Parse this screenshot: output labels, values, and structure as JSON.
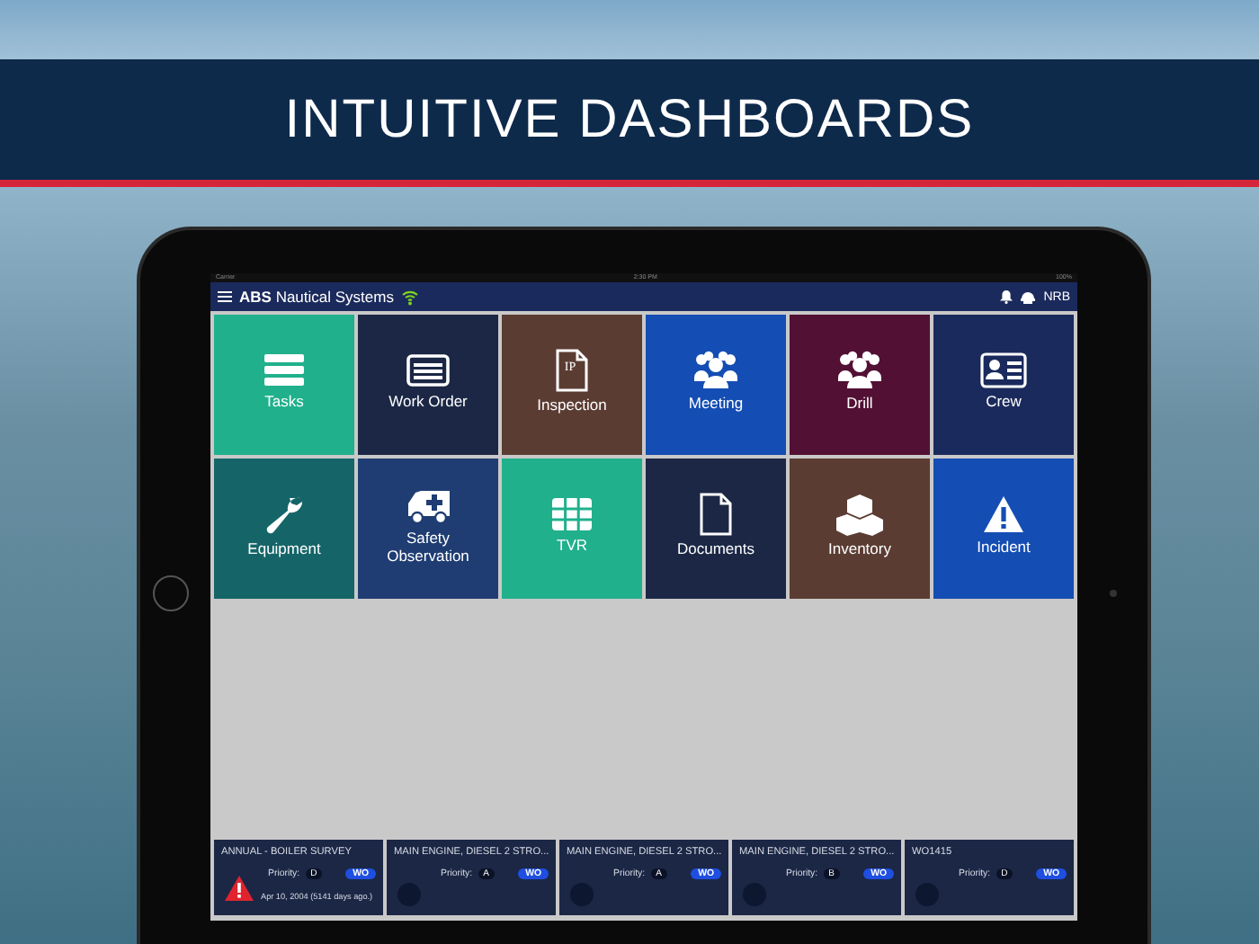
{
  "banner": {
    "title": "INTUITIVE DASHBOARDS"
  },
  "status_bar": {
    "carrier": "Carrier",
    "time": "2:30 PM",
    "battery": "100%"
  },
  "app_header": {
    "title": "**ABS** Nautical Systems",
    "user": "NRB"
  },
  "tiles": [
    {
      "label": "Tasks",
      "kind": "tasks",
      "color": "#20b08c"
    },
    {
      "label": "Work Order",
      "kind": "workorder",
      "color": "#1b2745"
    },
    {
      "label": "Inspection",
      "kind": "inspection",
      "color": "#5b3c33",
      "icon_text": "IP"
    },
    {
      "label": "Meeting",
      "kind": "meeting",
      "color": "#144db3"
    },
    {
      "label": "Drill",
      "kind": "drill",
      "color": "#521034"
    },
    {
      "label": "Crew",
      "kind": "crew",
      "color": "#1b2a5c"
    },
    {
      "label": "Equipment",
      "kind": "equipment",
      "color": "#156568"
    },
    {
      "label": "Safety Observation",
      "kind": "safety",
      "color": "#1f3d72"
    },
    {
      "label": "TVR",
      "kind": "tvr",
      "color": "#20b08c"
    },
    {
      "label": "Documents",
      "kind": "documents",
      "color": "#1b2745"
    },
    {
      "label": "Inventory",
      "kind": "inventory",
      "color": "#5b3c33"
    },
    {
      "label": "Incident",
      "kind": "incident",
      "color": "#144db3"
    }
  ],
  "work_orders": [
    {
      "title": "ANNUAL - BOILER SURVEY",
      "priority_label": "Priority:",
      "priority": "D",
      "badge": "WO",
      "kind": "alert",
      "date": "Apr 10, 2004 (5141 days ago.)"
    },
    {
      "title": "MAIN ENGINE, DIESEL 2 STRO...",
      "priority_label": "Priority:",
      "priority": "A",
      "badge": "WO",
      "kind": "plain"
    },
    {
      "title": "MAIN ENGINE, DIESEL 2 STRO...",
      "priority_label": "Priority:",
      "priority": "A",
      "badge": "WO",
      "kind": "plain"
    },
    {
      "title": "MAIN ENGINE, DIESEL 2 STRO...",
      "priority_label": "Priority:",
      "priority": "B",
      "badge": "WO",
      "kind": "plain"
    },
    {
      "title": "WO1415",
      "priority_label": "Priority:",
      "priority": "D",
      "badge": "WO",
      "kind": "plain"
    }
  ]
}
